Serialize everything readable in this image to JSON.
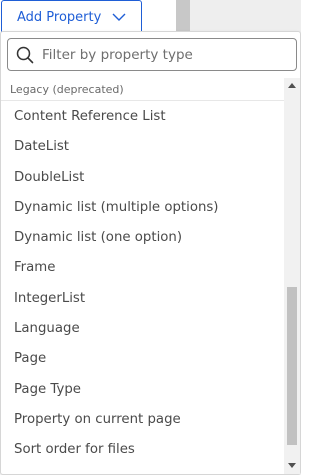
{
  "toolbar": {
    "add_property_label": "Add Property"
  },
  "search": {
    "placeholder": "Filter by property type",
    "value": ""
  },
  "dropdown": {
    "group_header": "Legacy (deprecated)",
    "items": [
      "Content Reference List",
      "DateList",
      "DoubleList",
      "Dynamic list (multiple options)",
      "Dynamic list (one option)",
      "Frame",
      "IntegerList",
      "Language",
      "Page",
      "Page Type",
      "Property on current page",
      "Sort order for files"
    ]
  },
  "colors": {
    "accent": "#1f5ed6",
    "text": "#4a4a4a",
    "muted": "#6a6a6a"
  },
  "icons": {
    "button_icon": "chevron-down-icon",
    "search_icon": "search-icon"
  }
}
